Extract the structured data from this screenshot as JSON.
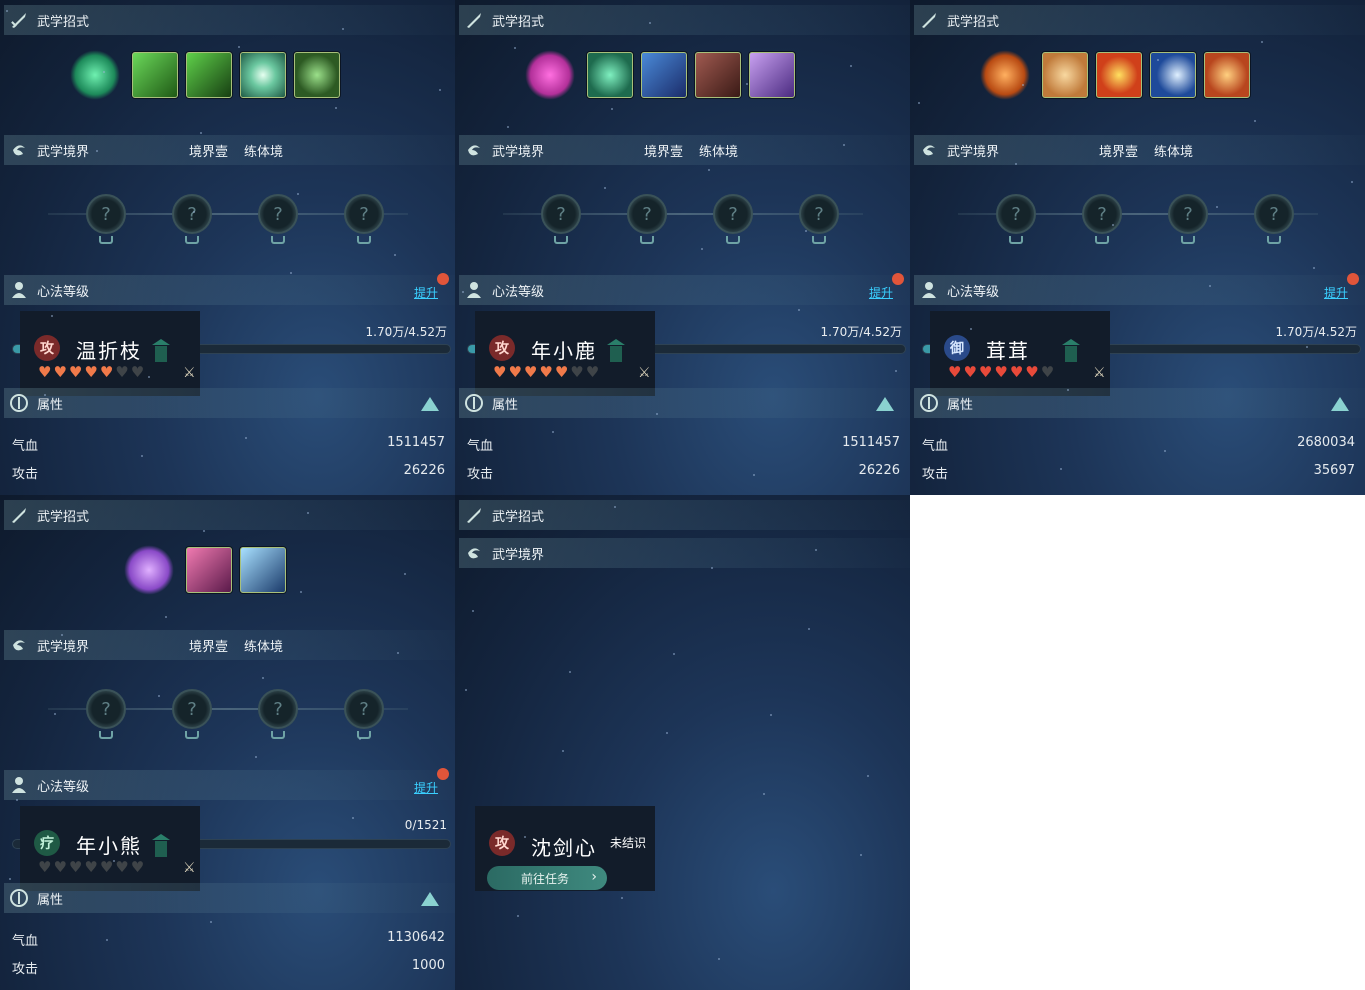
{
  "labels": {
    "skills_title": "武学招式",
    "realm_title": "武学境界",
    "realm_level": "境界壹",
    "realm_stage": "练体境",
    "xinfa_title": "心法等级",
    "raise": "提升",
    "attr_title": "属性",
    "hp": "气血",
    "atk": "攻击"
  },
  "panels": [
    {
      "name": "温折枝",
      "role": "攻",
      "progress": "1.70万/4.52万",
      "progress_fraction": 0.376,
      "stars_filled": 5,
      "stars_total": 7,
      "hp": "1511457",
      "atk": "26226",
      "skill_colors": [
        "#1d8a5a",
        "#2c7a1e",
        "#1f6d22",
        "#2a6f50",
        "#2d5a23"
      ]
    },
    {
      "name": "年小鹿",
      "role": "攻",
      "progress": "1.70万/4.52万",
      "progress_fraction": 0.376,
      "stars_filled": 5,
      "stars_total": 7,
      "hp": "1511457",
      "atk": "26226",
      "skill_colors": [
        "#b3309a",
        "#1e6b4e",
        "#1b4c8a",
        "#5a2a26",
        "#6a4aa0"
      ]
    },
    {
      "name": "茸茸",
      "role": "御",
      "progress": "1.70万/4.52万",
      "progress_fraction": 0.376,
      "stars_filled": 6,
      "stars_total": 7,
      "hp": "2680034",
      "atk": "35697",
      "skill_colors": [
        "#b84a12",
        "#c07a3a",
        "#d0401a",
        "#1e4a9a",
        "#b8461e"
      ]
    },
    {
      "name": "年小熊",
      "role": "疗",
      "progress": "0/1521",
      "progress_fraction": 0.0,
      "stars_filled": 0,
      "stars_total": 7,
      "hp": "1130642",
      "atk": "1000",
      "skill_colors": [
        "#8a4ac8",
        "#a23a7a",
        "#2a6a9a"
      ]
    },
    {
      "name": "沈剑心",
      "role": "攻",
      "status": "未结识",
      "action": "前往任务"
    }
  ],
  "colors": {
    "raise_link": "#3ad0ff",
    "heart_on": "#f07a4a",
    "heart_off": "#3f4448",
    "red_dot": "#e0553a"
  }
}
